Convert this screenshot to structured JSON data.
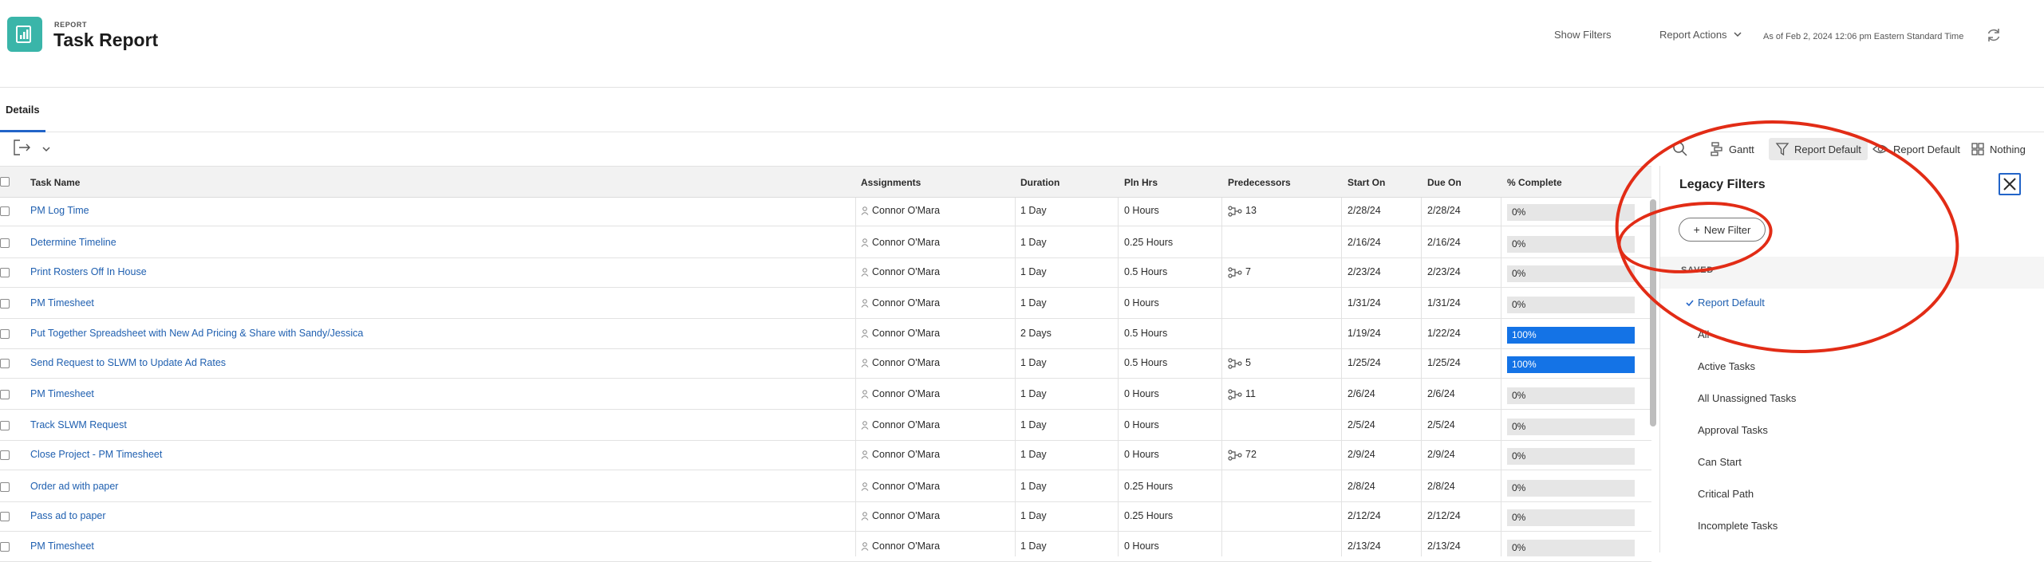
{
  "header": {
    "eyebrow": "REPORT",
    "title": "Task Report",
    "show_filters": "Show Filters",
    "report_actions": "Report Actions",
    "as_of": "As of Feb 2, 2024 12:06 pm Eastern Standard Time"
  },
  "tabs": [
    {
      "label": "Details"
    }
  ],
  "toolbar": {
    "gantt": "Gantt",
    "filter": "Report Default",
    "view": "Report Default",
    "group": "Nothing"
  },
  "table": {
    "columns": [
      "Task Name",
      "Assignments",
      "Duration",
      "Pln Hrs",
      "Predecessors",
      "Start On",
      "Due On",
      "% Complete"
    ],
    "rows": [
      {
        "task": "PM Log Time",
        "assignee": "Connor O'Mara",
        "duration": "1 Day",
        "pln": "0 Hours",
        "pred": "13",
        "start": "2/28/24",
        "due": "2/28/24",
        "pct": "0%",
        "pct_value": 0
      },
      {
        "task": "Determine Timeline",
        "assignee": "Connor O'Mara",
        "duration": "1 Day",
        "pln": "0.25 Hours",
        "pred": "",
        "start": "2/16/24",
        "due": "2/16/24",
        "pct": "0%",
        "pct_value": 0
      },
      {
        "task": "Print Rosters Off In House",
        "assignee": "Connor O'Mara",
        "duration": "1 Day",
        "pln": "0.5 Hours",
        "pred": "7",
        "start": "2/23/24",
        "due": "2/23/24",
        "pct": "0%",
        "pct_value": 0
      },
      {
        "task": "PM Timesheet",
        "assignee": "Connor O'Mara",
        "duration": "1 Day",
        "pln": "0 Hours",
        "pred": "",
        "start": "1/31/24",
        "due": "1/31/24",
        "pct": "0%",
        "pct_value": 0
      },
      {
        "task": "Put Together Spreadsheet with New Ad Pricing & Share with Sandy/Jessica",
        "assignee": "Connor O'Mara",
        "duration": "2 Days",
        "pln": "0.5 Hours",
        "pred": "",
        "start": "1/19/24",
        "due": "1/22/24",
        "pct": "100%",
        "pct_value": 100
      },
      {
        "task": "Send Request to SLWM to Update Ad Rates",
        "assignee": "Connor O'Mara",
        "duration": "1 Day",
        "pln": "0.5 Hours",
        "pred": "5",
        "start": "1/25/24",
        "due": "1/25/24",
        "pct": "100%",
        "pct_value": 100
      },
      {
        "task": "PM Timesheet",
        "assignee": "Connor O'Mara",
        "duration": "1 Day",
        "pln": "0 Hours",
        "pred": "11",
        "start": "2/6/24",
        "due": "2/6/24",
        "pct": "0%",
        "pct_value": 0
      },
      {
        "task": "Track SLWM Request",
        "assignee": "Connor O'Mara",
        "duration": "1 Day",
        "pln": "0 Hours",
        "pred": "",
        "start": "2/5/24",
        "due": "2/5/24",
        "pct": "0%",
        "pct_value": 0
      },
      {
        "task": "Close Project - PM Timesheet",
        "assignee": "Connor O'Mara",
        "duration": "1 Day",
        "pln": "0 Hours",
        "pred": "72",
        "start": "2/9/24",
        "due": "2/9/24",
        "pct": "0%",
        "pct_value": 0
      },
      {
        "task": "Order ad with paper",
        "assignee": "Connor O'Mara",
        "duration": "1 Day",
        "pln": "0.25 Hours",
        "pred": "",
        "start": "2/8/24",
        "due": "2/8/24",
        "pct": "0%",
        "pct_value": 0
      },
      {
        "task": "Pass ad to paper",
        "assignee": "Connor O'Mara",
        "duration": "1 Day",
        "pln": "0.25 Hours",
        "pred": "",
        "start": "2/12/24",
        "due": "2/12/24",
        "pct": "0%",
        "pct_value": 0
      },
      {
        "task": "PM Timesheet",
        "assignee": "Connor O'Mara",
        "duration": "1 Day",
        "pln": "0 Hours",
        "pred": "",
        "start": "2/13/24",
        "due": "2/13/24",
        "pct": "0%",
        "pct_value": 0
      }
    ]
  },
  "panel": {
    "title": "Legacy Filters",
    "new_filter": "New Filter",
    "saved_label": "SAVED",
    "items": [
      "Report Default",
      "All",
      "Active Tasks",
      "All Unassigned Tasks",
      "Approval Tasks",
      "Can Start",
      "Critical Path",
      "Incomplete Tasks"
    ],
    "selected": "Report Default"
  },
  "colors": {
    "accent": "#1473e6",
    "link": "#2060b0",
    "logo": "#3ab5a9",
    "annotation": "#e22c16"
  }
}
